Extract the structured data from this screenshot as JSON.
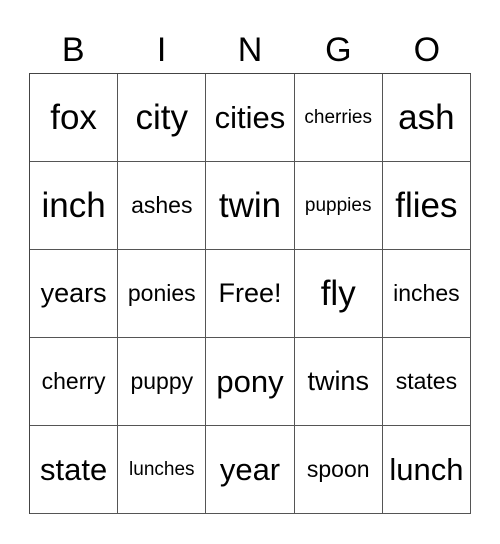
{
  "card": {
    "header": [
      "B",
      "I",
      "N",
      "G",
      "O"
    ],
    "rows": [
      [
        "fox",
        "city",
        "cities",
        "cherries",
        "ash"
      ],
      [
        "inch",
        "ashes",
        "twin",
        "puppies",
        "flies"
      ],
      [
        "years",
        "ponies",
        "Free!",
        "fly",
        "inches"
      ],
      [
        "cherry",
        "puppy",
        "pony",
        "twins",
        "states"
      ],
      [
        "state",
        "lunches",
        "year",
        "spoon",
        "lunch"
      ]
    ],
    "free_space": "Free!"
  }
}
